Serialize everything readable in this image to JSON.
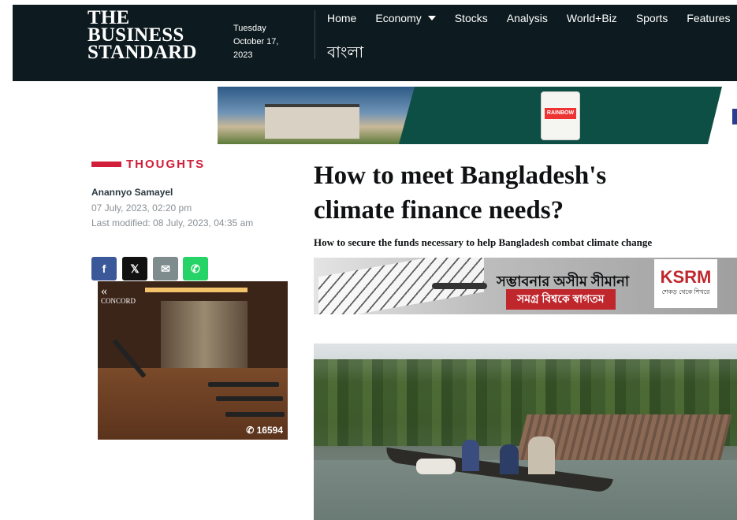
{
  "header": {
    "logo_line1": "THE",
    "logo_line2": "BUSINESS",
    "logo_line3": "STANDARD",
    "date_day": "Tuesday",
    "date_monthday": "October 17,",
    "date_year": "2023",
    "nav": [
      "Home",
      "Economy",
      "Stocks",
      "Analysis",
      "World+Biz",
      "Sports",
      "Features"
    ],
    "language_link": "বাংলা"
  },
  "top_ad": {
    "bucket_label": "RAINBOW"
  },
  "article": {
    "section": "THOUGHTS",
    "author": "Anannyo Samayel",
    "published": "07 July, 2023, 02:20 pm",
    "modified": "Last modified: 08 July, 2023, 04:35 am",
    "title": "How to meet Bangladesh's climate finance needs?",
    "subtitle": "How to secure the funds necessary to help Bangladesh combat climate change"
  },
  "share": {
    "facebook": "f",
    "twitter": "𝕏",
    "email": "✉",
    "whatsapp": "✆"
  },
  "sidebar_ad": {
    "brand": "CONCORD",
    "views": "16594",
    "views_icon": "whatsapp-icon"
  },
  "middle_ad": {
    "line1": "সম্ভাবনার অসীম সীমানা",
    "line2": "সমগ্র বিশ্বকে স্বাগতম",
    "brand": "KSRM",
    "tagline": "শেকড় থেকে শিখরে"
  },
  "colors": {
    "header_bg": "#0d1a1f",
    "accent_red": "#d11e3a",
    "facebook": "#3b5998",
    "whatsapp": "#25d366"
  }
}
